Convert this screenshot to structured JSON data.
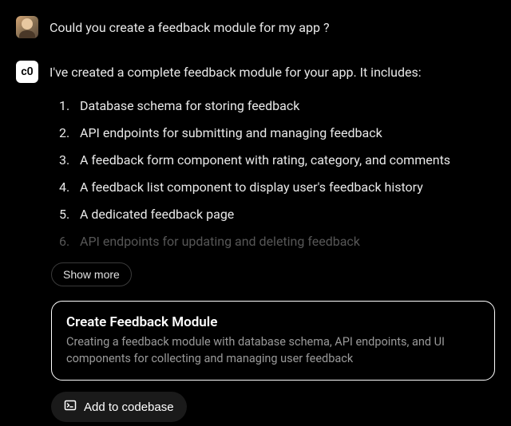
{
  "user_message": {
    "text": "Could you create a feedback module for my app ?"
  },
  "bot": {
    "name": "c0",
    "intro": "I've created a complete feedback module for your app. It includes:",
    "items": [
      "Database schema for storing feedback",
      "API endpoints for submitting and managing feedback",
      "A feedback form component with rating, category, and comments",
      "A feedback list component to display user's feedback history",
      "A dedicated feedback page",
      "API endpoints for updating and deleting feedback"
    ],
    "show_more": "Show more"
  },
  "card": {
    "title": "Create Feedback Module",
    "description": "Creating a feedback module with database schema, API endpoints, and UI components for collecting and managing user feedback"
  },
  "actions": {
    "add_to_codebase": "Add to codebase"
  }
}
